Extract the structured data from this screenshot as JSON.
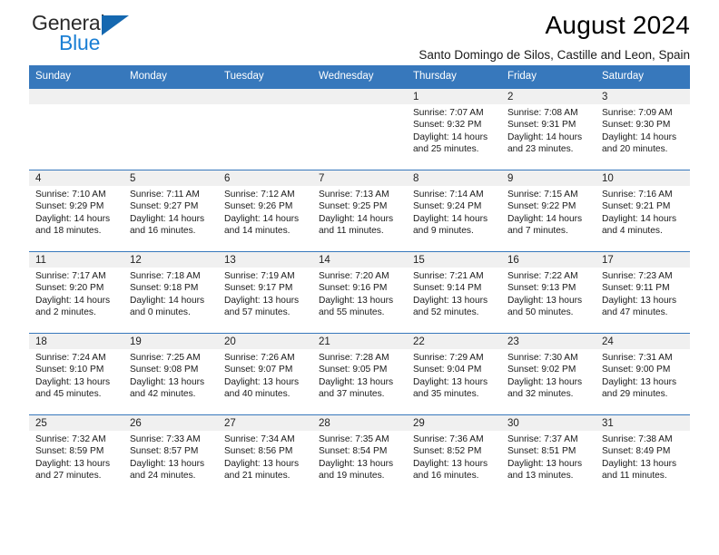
{
  "brand": {
    "name_top": "General",
    "name_bottom": "Blue",
    "triangle_color": "#1568b0",
    "blue_color": "#1b7fd4"
  },
  "header": {
    "title": "August 2024",
    "subtitle": "Santo Domingo de Silos, Castille and Leon, Spain"
  },
  "theme": {
    "header_bg": "#3778bc",
    "daynum_bg": "#f0f0f0",
    "row_border": "#3778bc"
  },
  "weekdays": [
    "Sunday",
    "Monday",
    "Tuesday",
    "Wednesday",
    "Thursday",
    "Friday",
    "Saturday"
  ],
  "labels": {
    "sunrise": "Sunrise:",
    "sunset": "Sunset:",
    "daylight": "Daylight:"
  },
  "weeks": [
    [
      {
        "day": "",
        "lines": []
      },
      {
        "day": "",
        "lines": []
      },
      {
        "day": "",
        "lines": []
      },
      {
        "day": "",
        "lines": []
      },
      {
        "day": "1",
        "lines": [
          "Sunrise: 7:07 AM",
          "Sunset: 9:32 PM",
          "Daylight: 14 hours",
          "and 25 minutes."
        ]
      },
      {
        "day": "2",
        "lines": [
          "Sunrise: 7:08 AM",
          "Sunset: 9:31 PM",
          "Daylight: 14 hours",
          "and 23 minutes."
        ]
      },
      {
        "day": "3",
        "lines": [
          "Sunrise: 7:09 AM",
          "Sunset: 9:30 PM",
          "Daylight: 14 hours",
          "and 20 minutes."
        ]
      }
    ],
    [
      {
        "day": "4",
        "lines": [
          "Sunrise: 7:10 AM",
          "Sunset: 9:29 PM",
          "Daylight: 14 hours",
          "and 18 minutes."
        ]
      },
      {
        "day": "5",
        "lines": [
          "Sunrise: 7:11 AM",
          "Sunset: 9:27 PM",
          "Daylight: 14 hours",
          "and 16 minutes."
        ]
      },
      {
        "day": "6",
        "lines": [
          "Sunrise: 7:12 AM",
          "Sunset: 9:26 PM",
          "Daylight: 14 hours",
          "and 14 minutes."
        ]
      },
      {
        "day": "7",
        "lines": [
          "Sunrise: 7:13 AM",
          "Sunset: 9:25 PM",
          "Daylight: 14 hours",
          "and 11 minutes."
        ]
      },
      {
        "day": "8",
        "lines": [
          "Sunrise: 7:14 AM",
          "Sunset: 9:24 PM",
          "Daylight: 14 hours",
          "and 9 minutes."
        ]
      },
      {
        "day": "9",
        "lines": [
          "Sunrise: 7:15 AM",
          "Sunset: 9:22 PM",
          "Daylight: 14 hours",
          "and 7 minutes."
        ]
      },
      {
        "day": "10",
        "lines": [
          "Sunrise: 7:16 AM",
          "Sunset: 9:21 PM",
          "Daylight: 14 hours",
          "and 4 minutes."
        ]
      }
    ],
    [
      {
        "day": "11",
        "lines": [
          "Sunrise: 7:17 AM",
          "Sunset: 9:20 PM",
          "Daylight: 14 hours",
          "and 2 minutes."
        ]
      },
      {
        "day": "12",
        "lines": [
          "Sunrise: 7:18 AM",
          "Sunset: 9:18 PM",
          "Daylight: 14 hours",
          "and 0 minutes."
        ]
      },
      {
        "day": "13",
        "lines": [
          "Sunrise: 7:19 AM",
          "Sunset: 9:17 PM",
          "Daylight: 13 hours",
          "and 57 minutes."
        ]
      },
      {
        "day": "14",
        "lines": [
          "Sunrise: 7:20 AM",
          "Sunset: 9:16 PM",
          "Daylight: 13 hours",
          "and 55 minutes."
        ]
      },
      {
        "day": "15",
        "lines": [
          "Sunrise: 7:21 AM",
          "Sunset: 9:14 PM",
          "Daylight: 13 hours",
          "and 52 minutes."
        ]
      },
      {
        "day": "16",
        "lines": [
          "Sunrise: 7:22 AM",
          "Sunset: 9:13 PM",
          "Daylight: 13 hours",
          "and 50 minutes."
        ]
      },
      {
        "day": "17",
        "lines": [
          "Sunrise: 7:23 AM",
          "Sunset: 9:11 PM",
          "Daylight: 13 hours",
          "and 47 minutes."
        ]
      }
    ],
    [
      {
        "day": "18",
        "lines": [
          "Sunrise: 7:24 AM",
          "Sunset: 9:10 PM",
          "Daylight: 13 hours",
          "and 45 minutes."
        ]
      },
      {
        "day": "19",
        "lines": [
          "Sunrise: 7:25 AM",
          "Sunset: 9:08 PM",
          "Daylight: 13 hours",
          "and 42 minutes."
        ]
      },
      {
        "day": "20",
        "lines": [
          "Sunrise: 7:26 AM",
          "Sunset: 9:07 PM",
          "Daylight: 13 hours",
          "and 40 minutes."
        ]
      },
      {
        "day": "21",
        "lines": [
          "Sunrise: 7:28 AM",
          "Sunset: 9:05 PM",
          "Daylight: 13 hours",
          "and 37 minutes."
        ]
      },
      {
        "day": "22",
        "lines": [
          "Sunrise: 7:29 AM",
          "Sunset: 9:04 PM",
          "Daylight: 13 hours",
          "and 35 minutes."
        ]
      },
      {
        "day": "23",
        "lines": [
          "Sunrise: 7:30 AM",
          "Sunset: 9:02 PM",
          "Daylight: 13 hours",
          "and 32 minutes."
        ]
      },
      {
        "day": "24",
        "lines": [
          "Sunrise: 7:31 AM",
          "Sunset: 9:00 PM",
          "Daylight: 13 hours",
          "and 29 minutes."
        ]
      }
    ],
    [
      {
        "day": "25",
        "lines": [
          "Sunrise: 7:32 AM",
          "Sunset: 8:59 PM",
          "Daylight: 13 hours",
          "and 27 minutes."
        ]
      },
      {
        "day": "26",
        "lines": [
          "Sunrise: 7:33 AM",
          "Sunset: 8:57 PM",
          "Daylight: 13 hours",
          "and 24 minutes."
        ]
      },
      {
        "day": "27",
        "lines": [
          "Sunrise: 7:34 AM",
          "Sunset: 8:56 PM",
          "Daylight: 13 hours",
          "and 21 minutes."
        ]
      },
      {
        "day": "28",
        "lines": [
          "Sunrise: 7:35 AM",
          "Sunset: 8:54 PM",
          "Daylight: 13 hours",
          "and 19 minutes."
        ]
      },
      {
        "day": "29",
        "lines": [
          "Sunrise: 7:36 AM",
          "Sunset: 8:52 PM",
          "Daylight: 13 hours",
          "and 16 minutes."
        ]
      },
      {
        "day": "30",
        "lines": [
          "Sunrise: 7:37 AM",
          "Sunset: 8:51 PM",
          "Daylight: 13 hours",
          "and 13 minutes."
        ]
      },
      {
        "day": "31",
        "lines": [
          "Sunrise: 7:38 AM",
          "Sunset: 8:49 PM",
          "Daylight: 13 hours",
          "and 11 minutes."
        ]
      }
    ]
  ]
}
